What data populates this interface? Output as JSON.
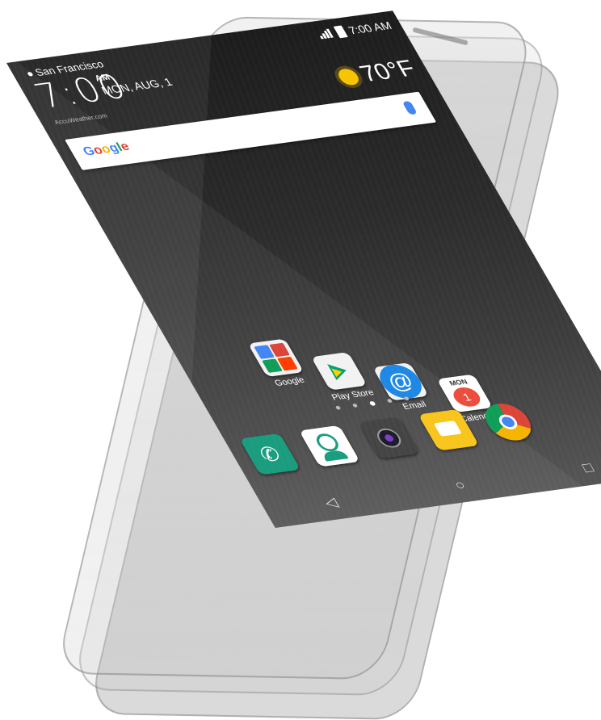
{
  "status_bar": {
    "time": "7:00 AM"
  },
  "clock_widget": {
    "location": "San Francisco",
    "time": "7:00",
    "ampm": "AM",
    "date": "MON, AUG, 1",
    "source": "AccuWeather.com"
  },
  "weather": {
    "icon": "sun-icon",
    "temperature": "70°F"
  },
  "search_bar": {
    "logo_text": "Google",
    "mic_icon": "microphone-icon"
  },
  "apps": [
    {
      "label": "Google",
      "icon": "google-folder-icon"
    },
    {
      "label": "Play Store",
      "icon": "play-store-icon"
    },
    {
      "label": "Email",
      "icon": "email-icon",
      "glyph": "@"
    },
    {
      "label": "Calendar",
      "icon": "calendar-icon",
      "month": "MON",
      "day": "1"
    }
  ],
  "dock": [
    {
      "icon": "phone-icon",
      "glyph": "✆"
    },
    {
      "icon": "contacts-icon"
    },
    {
      "icon": "camera-icon"
    },
    {
      "icon": "messaging-icon"
    },
    {
      "icon": "chrome-icon"
    }
  ],
  "nav": {
    "back": "◁",
    "home": "○",
    "recents": "□"
  },
  "colors": {
    "google_blue": "#4285f4",
    "phone_green": "#1a9c7e",
    "calendar_red": "#ec4c3c",
    "message_yellow": "#f8c51c"
  }
}
